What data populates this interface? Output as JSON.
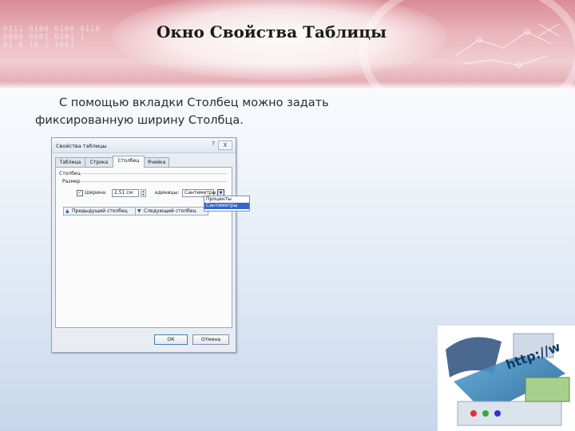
{
  "slide": {
    "title": "Окно Свойства Таблицы",
    "text_line1_words": [
      "С",
      "помощью",
      "вкладки",
      "Столбец",
      "можно",
      "задать"
    ],
    "text_line2": "фиксированную ширину Столбца."
  },
  "dialog": {
    "title": "Свойства таблицы",
    "help": "?",
    "close": "X",
    "tabs": [
      {
        "label": "Таблица",
        "active": false
      },
      {
        "label": "Строка",
        "active": false
      },
      {
        "label": "Столбец",
        "active": true
      },
      {
        "label": "Ячейка",
        "active": false
      }
    ],
    "section_label": "Столбец",
    "size_label": "Размер",
    "width_checkbox_label": "Ширина:",
    "width_checked": true,
    "width_value": "2,51 см",
    "units_label": "единицы:",
    "units_value": "Сантиметры",
    "units_options": [
      {
        "label": "Проценты",
        "selected": false
      },
      {
        "label": "Сантиметры",
        "selected": true
      }
    ],
    "prev_button": "Предыдущий столбец",
    "next_button": "Следующий столбец",
    "ok_button": "ОК",
    "cancel_button": "Отмена"
  },
  "decor": {
    "http_text": "http://w"
  },
  "colors": {
    "banner": "#e2a3ab",
    "background": "#dde7f4",
    "dialog_face": "#e9edf3",
    "selection": "#3366cc"
  }
}
